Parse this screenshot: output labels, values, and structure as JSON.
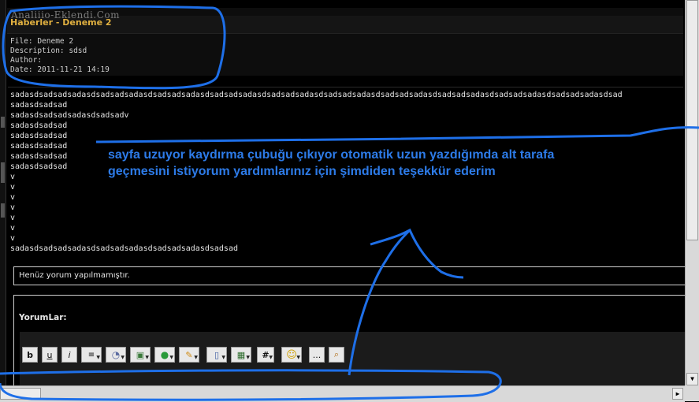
{
  "header": {
    "logo_text": "Analiiio-Eklendi.Com",
    "title": "Haberler - Deneme 2",
    "file": "File: Deneme 2",
    "description": "Description: sdsd",
    "author": "Author:",
    "date": "Date: 2011-11-21 14:19"
  },
  "content_lines": [
    "sadasdsadsadsadasdsadsadsadasdsadsadsadasdsadsadsadasdsadsadsadasdsadsadsadasdsadsadsadasdsadsadsadasdsadsadsadasdsadsadsadasdsad",
    "sadasdsadsad",
    "sadasdsadsadsadasdsadsadv",
    "sadasdsadsad",
    "sadasdsadsad",
    "sadasdsadsad",
    "sadasdsadsad",
    "sadasdsadsad",
    "v",
    "v",
    "v",
    "v",
    "v",
    "v",
    "v",
    "sadasdsadsadsadasdsadsadsadasdsadsadsadasdsadsad"
  ],
  "annotation": {
    "line1": "sayfa uzuyor kaydırma çubuğu çıkıyor otomatik uzun yazdığımda alt tarafa",
    "line2": "geçmesini istiyorum yardımlarınız için şimdiden teşekkür ederim",
    "color": "#2d7be8"
  },
  "comments": {
    "empty_text": "Henüz yorum yapılmamıştır.",
    "form_label": "YorumLar:"
  },
  "toolbar": {
    "buttons": [
      {
        "icon": "bold-icon",
        "label": "b"
      },
      {
        "icon": "underline-icon",
        "label": "u"
      },
      {
        "icon": "italic-icon",
        "label": "i"
      },
      {
        "icon": "align-icon",
        "label": ""
      },
      {
        "icon": "font-icon",
        "label": ""
      },
      {
        "icon": "image-icon",
        "label": ""
      },
      {
        "icon": "color-icon",
        "label": ""
      },
      {
        "icon": "highlight-icon",
        "label": ""
      },
      {
        "icon": "document-icon",
        "label": ""
      },
      {
        "icon": "table-icon",
        "label": ""
      },
      {
        "icon": "hash-icon",
        "label": "#"
      },
      {
        "icon": "smiley-icon",
        "label": ""
      },
      {
        "icon": "more-icon",
        "label": "..."
      },
      {
        "icon": "search-icon",
        "label": ""
      }
    ]
  }
}
